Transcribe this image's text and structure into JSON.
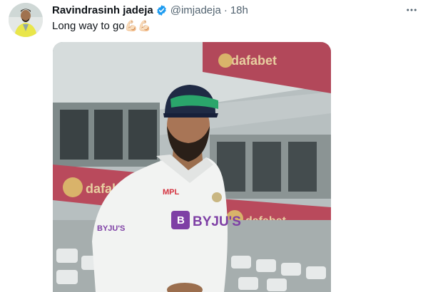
{
  "tweet": {
    "author_name": "Ravindrasinh jadeja",
    "handle": "@imjadeja",
    "separator": "·",
    "time": "18h",
    "text": "Long way to go",
    "emoji": "💪🏻💪🏻",
    "more_icon": "more-horizontal-icon",
    "verified_icon": "verified-badge-icon",
    "colors": {
      "verified": "#1d9bf0",
      "secondary_text": "#536471"
    }
  },
  "media": {
    "banner_texts": [
      "dafabet",
      "dafabet",
      "dafabet",
      "dafabet",
      "dafabet"
    ],
    "shirt_sponsor": "BYJU'S",
    "shirt_logo": "MPL",
    "sleeve_text": "BYJU'S"
  }
}
